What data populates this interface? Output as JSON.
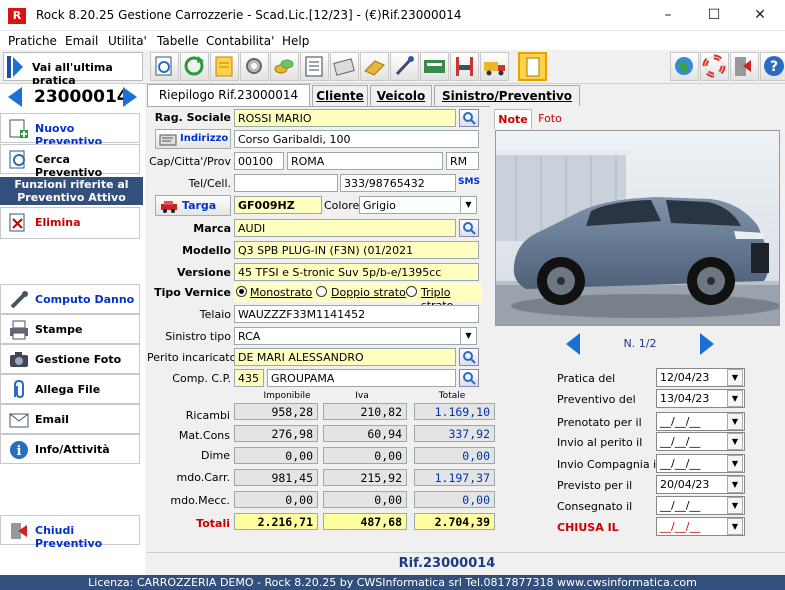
{
  "window": {
    "title": "Rock 8.20.25 Gestione Carrozzerie - Scad.Lic.[12/23] - (€)Rif.23000014",
    "icon_letter": "R"
  },
  "menu": [
    "Pratiche",
    "Email",
    "Utilita'",
    "Tabelle",
    "Contabilita'",
    "Help"
  ],
  "toolbar": {
    "goto_last": "Vai all'ultima pratica"
  },
  "left": {
    "practice_number": "23000014",
    "new_quote": "Nuovo Preventivo",
    "search_quote": "Cerca Preventivo",
    "functions_header": "Funzioni riferite al Preventivo Attivo",
    "delete": "Elimina",
    "compute_damage": "Computo Danno",
    "print": "Stampe",
    "photo_mgmt": "Gestione Foto",
    "attach_file": "Allega File",
    "email": "Email",
    "info": "Info/Attività",
    "close_quote": "Chiudi Preventivo"
  },
  "tabs": [
    "Riepilogo Rif.23000014",
    "Cliente",
    "Veicolo",
    "Sinistro/Preventivo"
  ],
  "form": {
    "rag_sociale_label": "Rag. Sociale",
    "rag_sociale": "ROSSI MARIO",
    "indirizzo_btn": "Indirizzo",
    "indirizzo": "Corso Garibaldi, 100",
    "cap_label": "Cap/Citta'/Prov",
    "cap": "00100",
    "citta": "ROMA",
    "prov": "RM",
    "tel_label": "Tel/Cell.",
    "tel": "",
    "cell": "333/98765432",
    "sms": "SMS",
    "targa_btn": "Targa",
    "targa": "GF009HZ",
    "colore_label": "Colore",
    "colore": "Grigio",
    "marca_label": "Marca",
    "marca": "AUDI",
    "modello_label": "Modello",
    "modello": "Q3 SPB PLUG-IN (F3N) (01/2021",
    "versione_label": "Versione",
    "versione": "45 TFSI e S-tronic Suv 5p/b-e/1395cc",
    "tipo_vernice_label": "Tipo Vernice",
    "vernice_options": [
      "Monostrato",
      "Doppio strato",
      "Triplo strato"
    ],
    "vernice_selected": 0,
    "telaio_label": "Telaio",
    "telaio": "WAUZZZF33M1141452",
    "sinistro_label": "Sinistro tipo",
    "sinistro": "RCA",
    "perito_label": "Perito incaricato",
    "perito": "DE MARI ALESSANDRO",
    "comp_label": "Comp. C.P.",
    "comp_code": "435",
    "comp_name": "GROUPAMA"
  },
  "totals": {
    "headers": [
      "Imponibile",
      "Iva",
      "Totale"
    ],
    "rows": [
      {
        "label": "Ricambi",
        "imp": "958,28",
        "iva": "210,82",
        "tot": "1.169,10"
      },
      {
        "label": "Mat.Cons",
        "imp": "276,98",
        "iva": "60,94",
        "tot": "337,92"
      },
      {
        "label": "Dime",
        "imp": "0,00",
        "iva": "0,00",
        "tot": "0,00"
      },
      {
        "label": "mdo.Carr.",
        "imp": "981,45",
        "iva": "215,92",
        "tot": "1.197,37"
      },
      {
        "label": "mdo.Mecc.",
        "imp": "0,00",
        "iva": "0,00",
        "tot": "0,00"
      }
    ],
    "total_label": "Totali",
    "total_imp": "2.216,71",
    "total_iva": "487,68",
    "total_tot": "2.704,39"
  },
  "photo": {
    "tab_note": "Note",
    "tab_foto": "Foto",
    "counter": "N. 1/2"
  },
  "dates": [
    {
      "label": "Pratica del",
      "value": "12/04/23"
    },
    {
      "label": "Preventivo del",
      "value": "13/04/23"
    },
    {
      "label": "Prenotato per il",
      "value": "__/__/__"
    },
    {
      "label": "Invio al perito il",
      "value": "__/__/__"
    },
    {
      "label": "Invio Compagnia il",
      "value": "__/__/__"
    },
    {
      "label": "Previsto per il",
      "value": "20/04/23"
    },
    {
      "label": "Consegnato il",
      "value": "__/__/__"
    },
    {
      "label": "CHIUSA IL",
      "value": "__/__/__"
    }
  ],
  "footer_ref": "Rif.23000014",
  "status": "Licenza: CARROZZERIA DEMO - Rock 8.20.25 by CWSInformatica srl Tel.0817877318  www.cwsinformatica.com",
  "colors": {
    "accent": "#0033cc",
    "field_yellow": "#ffffc0",
    "status_bar": "#33507c",
    "danger": "#cc0000"
  }
}
